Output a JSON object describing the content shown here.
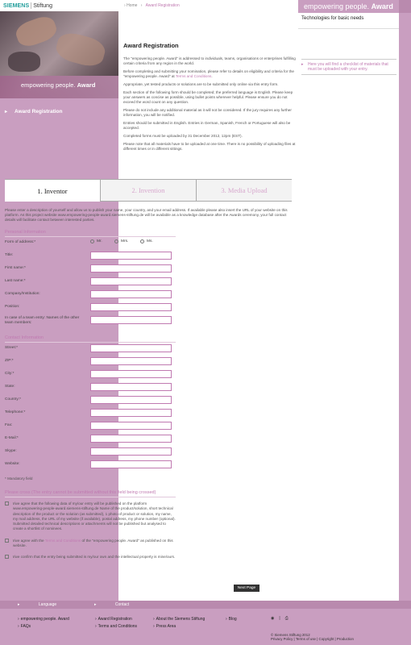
{
  "header": {
    "logo_brand": "SIEMENS",
    "logo_name": "Stiftung",
    "breadcrumb": {
      "home": "Home",
      "current": "Award Registration"
    },
    "banner_left": "empowering people.",
    "banner_bold": "Award",
    "banner_tagline": "Technologies for basic needs"
  },
  "sidebar": {
    "caption_left": "empowering people.",
    "caption_bold": "Award",
    "nav_item": "Award Registration"
  },
  "right": {
    "checklist": "Here you will find a checklist of materials that must be uploaded with your entry."
  },
  "main": {
    "title": "Award Registration",
    "intro_1": "The \"empowering people. Award\" is addressed to individuals, teams, organisations or enterprises fulfilling certain criteria from any region in the world.",
    "intro_2a": "Before completing and submitting your nomination, please refer to details on eligibility and criteria for the \"empowering people. Award\" at",
    "intro_2_link": "Terms and Conditions",
    "intro_2b": ".",
    "intro_3": "Appropriate, yet tested products or solutions are to be submitted only online via this entry form.",
    "intro_4": "Each section of the following form should be completed; the preferred language is English. Please keep your answers as concise as possible, using bullet points wherever helpful. Please ensure you do not exceed the word count on any question.",
    "intro_5": "Please do not include any additional material as it will not be considered. If the jury requires any further information, you will be notified.",
    "intro_6": "Entries should be submitted in English. Entries in German, Spanish, French or Portuguese will also be accepted.",
    "intro_7": "Completed forms must be uploaded by 31 December 2012, 12pm (EST).",
    "intro_8": "Please note that all materials have to be uploaded at one time. There is no possibility of uploading files at different times or in different sittings."
  },
  "tabs": [
    "1. Inventor",
    "2. Invention",
    "3. Media Upload"
  ],
  "form": {
    "description": "Please enter a description of yourself and allow us to publish your name, your country, and your email address. If available please also insert the URL of your website on this platform. As this project website www.empowering-people-award.siemens-stiftung.de will be available as a knowledge database after the Awards ceremony, your full contact details will facilitate contact between interested parties.",
    "personal_heading": "Personal Information",
    "form_of_address": "Form of address:*",
    "radio_mr": "Mr.",
    "radio_mrs": "Mrs.",
    "radio_ms": "Ms.",
    "personal_fields": [
      "Title:",
      "First name:*",
      "Last name:*",
      "Company/Institution:",
      "Position:",
      "In case of a team entry: Names of the other team members:"
    ],
    "contact_heading": "Contact Information",
    "contact_fields": [
      "Street:*",
      "ZIP:*",
      "City:*",
      "State:",
      "Country:*",
      "Telephone:*",
      "Fax:",
      "E-Mail:*",
      "Skype:",
      "Website:"
    ],
    "mandatory_note": "* Mandatory field",
    "cross_heading": "Please cross (The entry cannot be submitted without this field being crossed)",
    "check_1": "I/we agree that the following data of my/our entry will be published on the platform www.empowering-people-award.siemens-stiftung.de Name of the product/solution, short technical description of the product or the solution (as submitted), 1 photo of product or solution, my name, my mail address, the URL of my website (if available), postal address, my phone number (optional). Submitted detailed technical descriptions or attachments will not be published but analysed to create a shortlist of nominees.",
    "check_2a": "I/we agree with the",
    "check_2_link": "Terms and Conditions",
    "check_2b": "of the \"empowering people. Award\" as published on this website.",
    "check_3": "I/we confirm that the entry being submitted is my/our own and the intellectual property is mine/ours.",
    "next_button": "Next Page"
  },
  "footer": {
    "language": "Language",
    "contact": "Contact",
    "col1": [
      "empowering people. Award",
      "FAQs"
    ],
    "col2": [
      "Award Registration",
      "Terms and Conditions"
    ],
    "col3": [
      "About the Siemens Stiftung",
      "Press Area"
    ],
    "col4": [
      "Blog"
    ],
    "copyright": "© Siemens Stiftung 2012",
    "links": "Privacy Policy | Terms of use | Copyright | Production"
  }
}
